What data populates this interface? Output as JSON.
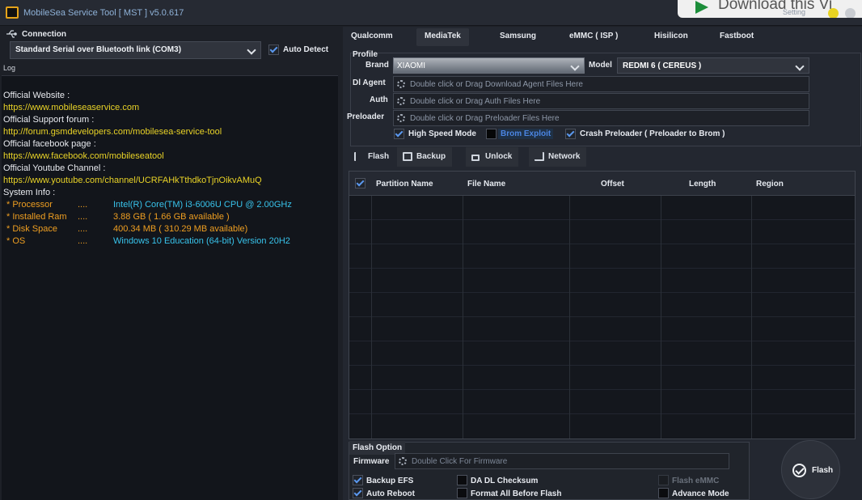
{
  "app": {
    "title": "MobileSea Service Tool [ MST ] v5.0.617"
  },
  "overlay": {
    "banner_text": "Download this Vi",
    "setting_label": "Setting"
  },
  "connection": {
    "header": "Connection",
    "selected_port": "Standard Serial over Bluetooth link (COM3)",
    "auto_detect_label": "Auto Detect",
    "auto_detect_checked": true
  },
  "log": {
    "header": "Log",
    "lines": [
      {
        "text": "Official Website :",
        "color": "white"
      },
      {
        "text": "https://www.mobileseaservice.com",
        "color": "yellow"
      },
      {
        "text": "Official Support forum :",
        "color": "white"
      },
      {
        "text": "http://forum.gsmdevelopers.com/mobilesea-service-tool",
        "color": "yellow"
      },
      {
        "text": "Official facebook page :",
        "color": "white"
      },
      {
        "text": "https://www.facebook.com/mobileseatool",
        "color": "yellow"
      },
      {
        "text": "Official Youtube Channel :",
        "color": "white"
      },
      {
        "text": "https://www.youtube.com/channel/UCRFAHkTthdkoTjnOikvAMuQ",
        "color": "yellow"
      },
      {
        "text": "System Info :",
        "color": "white"
      }
    ],
    "system_info": [
      {
        "label": "* Processor",
        "dots": "....",
        "value": "Intel(R) Core(TM) i3-6006U CPU @ 2.00GHz"
      },
      {
        "label": "* Installed Ram",
        "dots": "....",
        "value": "3.88 GB  ( 1.66 GB  available )"
      },
      {
        "label": "* Disk Space",
        "dots": "....",
        "value": "400.34 MB ( 310.29 MB  available)"
      },
      {
        "label": "* OS",
        "dots": "....",
        "value": "Windows 10 Education (64-bit) Version 20H2"
      }
    ]
  },
  "tabs": [
    "Qualcomm",
    "MediaTek",
    "Samsung",
    "eMMC ( ISP )",
    "Hisilicon",
    "Fastboot"
  ],
  "active_tab": "MediaTek",
  "profile": {
    "section": "Profile",
    "brand_label": "Brand",
    "brand_value": "XIAOMI",
    "model_label": "Model",
    "model_value": "REDMI 6 ( CEREUS )",
    "dl_agent_label": "Dl Agent",
    "dl_agent_placeholder": "Double click or Drag Download Agent Files Here",
    "auth_label": "Auth",
    "auth_placeholder": "Double click or Drag Auth Files Here",
    "preloader_label": "Preloader",
    "preloader_placeholder": "Double click or Drag Preloader Files Here",
    "high_speed_label": "High Speed Mode",
    "brom_exploit_label": "Brom Exploit",
    "crash_preloader_label": "Crash Preloader ( Preloader to Brom )"
  },
  "sub_tabs": [
    "Flash",
    "Backup",
    "Unlock",
    "Network"
  ],
  "grid": {
    "columns": [
      "Partition Name",
      "File Name",
      "Offset",
      "Length",
      "Region"
    ]
  },
  "flash_option": {
    "title": "Flash Option",
    "firmware_label": "Firmware",
    "firmware_placeholder": "Double Click For Firmware",
    "backup_efs_label": "Backup EFS",
    "auto_reboot_label": "Auto Reboot",
    "da_dl_checksum_label": "DA DL Checksum",
    "format_all_label": "Format All Before Flash",
    "flash_emmc_label": "Flash eMMC",
    "advance_mode_label": "Advance Mode"
  },
  "flash_button_label": "Flash",
  "colors": {
    "accent_blue": "#5b98ee",
    "log_yellow": "#e9d327",
    "log_orange": "#ee9e21",
    "log_cyan": "#38c3eb"
  }
}
